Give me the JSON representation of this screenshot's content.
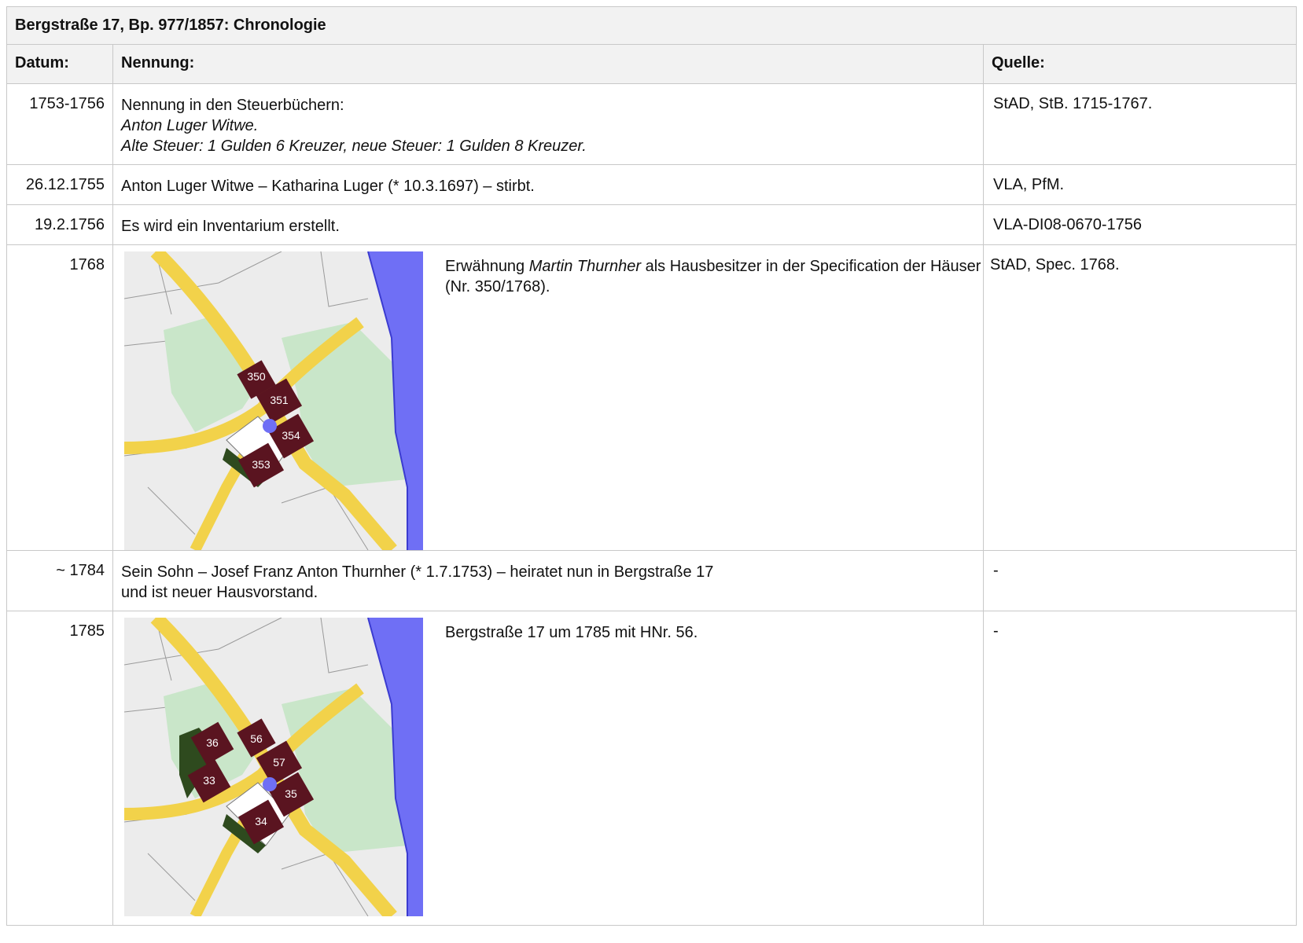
{
  "title": "Bergstraße 17, Bp. 977/1857: Chronologie",
  "headers": {
    "date": "Datum:",
    "mention": "Nennung:",
    "source": "Quelle:"
  },
  "rows": [
    {
      "date": "1753-1756",
      "line1": "Nennung in den Steuerbüchern:",
      "line2": "Anton Luger Witwe.",
      "line3": "Alte Steuer: 1 Gulden 6 Kreuzer, neue Steuer: 1 Gulden 8 Kreuzer.",
      "source": "StAD, StB. 1715-1767."
    },
    {
      "date": "26.12.1755",
      "text": "Anton Luger Witwe – Katharina Luger (* 10.3.1697) – stirbt.",
      "source": "VLA, PfM."
    },
    {
      "date": "19.2.1756",
      "text": "Es wird ein Inventarium erstellt.",
      "source": "VLA-DI08-0670-1756"
    },
    {
      "date": "1768",
      "pre": "Erwähnung ",
      "name": "Martin Thurnher",
      "post": " als Hausbesitzer in der Specification der Häuser (Nr. 350/1768).",
      "source": "StAD, Spec. 1768.",
      "map_labels": [
        "350",
        "351",
        "354",
        "353"
      ]
    },
    {
      "date": "~ 1784",
      "text": "Sein Sohn – Josef Franz Anton Thurnher (* 1.7.1753) – heiratet nun in Bergstraße 17 und ist neuer Hausvorstand.",
      "source": "-"
    },
    {
      "date": "1785",
      "text": "Bergstraße 17 um 1785 mit HNr. 56.",
      "source": "-",
      "map_labels": [
        "56",
        "57",
        "36",
        "33",
        "35",
        "34"
      ]
    }
  ],
  "colors": {
    "header_bg": "#f2f2f2",
    "border": "#c8c8c8",
    "river": "#6f6ff5",
    "road": "#f2d24a",
    "meadow": "#c9e6c9",
    "house": "#5a1420"
  }
}
